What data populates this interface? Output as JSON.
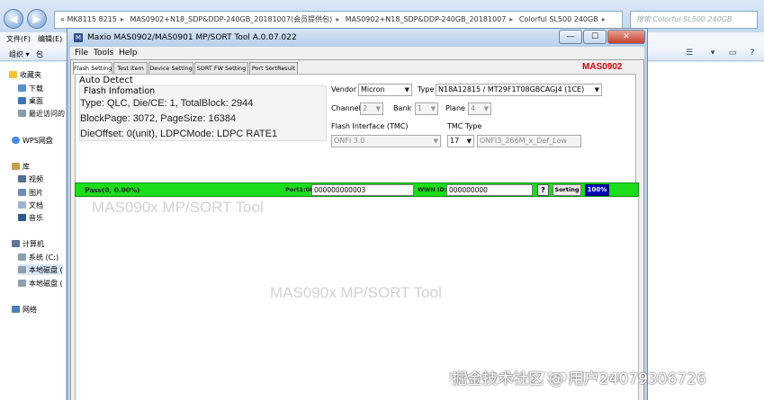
{
  "explorer": {
    "address_parts": [
      "MK8115 8215",
      "MAS0902+N18_SDP&DDP-240GB_20181007(会员提供包)",
      "MAS0902+N18_SDP&DDP-240GB_20181007",
      "Colorful SL500 240GB"
    ],
    "search_placeholder": "搜索 Colorful SL500 240GB",
    "menu": [
      "文件(F)",
      "编辑(E)"
    ],
    "toolbar": {
      "organize": "组织 ▾",
      "include": "包"
    },
    "sidebar": {
      "favorites": "收藏夹",
      "downloads": "下载",
      "desktop": "桌面",
      "recent": "最近访问的",
      "wps": "WPS网盘",
      "libraries": "库",
      "videos": "视频",
      "pictures": "图片",
      "documents": "文档",
      "music": "音乐",
      "computer": "计算机",
      "system_c": "系统 (C:)",
      "local_disk_1": "本地磁盘 (",
      "local_disk_2": "本地磁盘 (",
      "network": "网络"
    }
  },
  "tool": {
    "title": "Maxio MAS0902/MAS0901 MP/SORT Tool A.0.07.022",
    "menu": [
      "File",
      "Tools",
      "Help"
    ],
    "tabs": [
      "Flash Setting",
      "Test item",
      "Device Setting",
      "SORT FW Setting",
      "Port SortResult"
    ],
    "model": "MAS0902",
    "auto_detect": {
      "title": "Auto Detect",
      "flash_info_title": "Flash Infomation",
      "line1": "Type: QLC, Die/CE: 1, TotalBlock: 2944",
      "line2": "BlockPage: 3072, PageSize: 16384",
      "line3": "DieOffset: 0(unit), LDPCMode: LDPC RATE1"
    },
    "settings": {
      "vendor_label": "Vendor",
      "vendor_value": "Micron",
      "type_label": "Type",
      "type_value": "N18A12815  /  MT29F1T08GBCAGJ4 (1CE)",
      "channel_label": "Channel",
      "channel_value": "2",
      "bank_label": "Bank",
      "bank_value": "1",
      "plane_label": "Plane",
      "plane_value": "4",
      "interface_label": "Flash Interface (TMC)",
      "interface_value": "ONFI 3.0",
      "tmc_label": "TMC Type",
      "tmc_num": "17",
      "tmc_value": "ONFI3_266M_x_Def_Low"
    },
    "status_bar": {
      "pass": "Pass(0, 0.00%)",
      "port_label": "Port1:0E",
      "port_value": "000000000003",
      "wwn_label": "WWN ID:",
      "wwn_value": "000000000",
      "help": "?",
      "sorting": "Sorting",
      "percent": "100%"
    },
    "watermark": "MAS090x MP/SORT Tool"
  },
  "corner_watermark": "掘金技术社区 @ 用户24079306726",
  "colors": {
    "status_green": "#1cdc1c",
    "model_red": "#d40000",
    "percent_blue": "#0000b8"
  }
}
